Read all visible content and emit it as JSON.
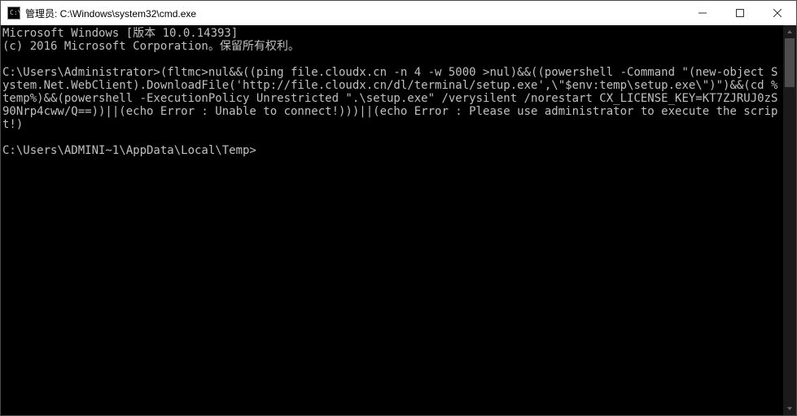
{
  "window": {
    "title": "管理员: C:\\Windows\\system32\\cmd.exe"
  },
  "terminal": {
    "lines": [
      "Microsoft Windows [版本 10.0.14393]",
      "(c) 2016 Microsoft Corporation。保留所有权利。",
      "",
      "C:\\Users\\Administrator>(fltmc>nul&&((ping file.cloudx.cn -n 4 -w 5000 >nul)&&((powershell -Command \"(new-object System.Net.WebClient).DownloadFile('http://file.cloudx.cn/dl/terminal/setup.exe',\\\"$env:temp\\setup.exe\\\")\")&&(cd %temp%)&&(powershell -ExecutionPolicy Unrestricted \".\\setup.exe\" /verysilent /norestart CX_LICENSE_KEY=KT7ZJRUJ0zS90Nrp4cww/Q==))||(echo Error : Unable to connect!)))||(echo Error : Please use administrator to execute the script!)",
      "",
      "C:\\Users\\ADMINI~1\\AppData\\Local\\Temp>"
    ]
  }
}
